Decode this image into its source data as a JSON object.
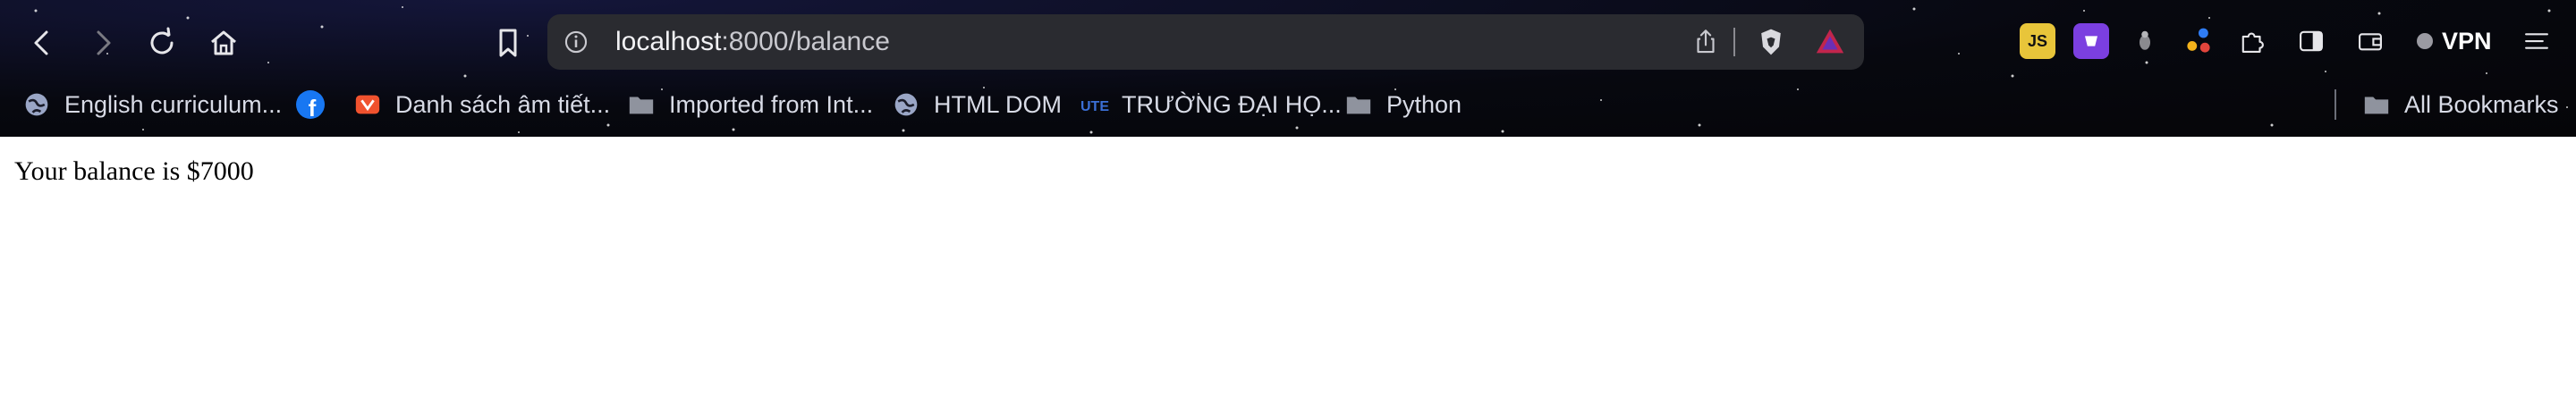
{
  "toolbar": {
    "back_icon": "back-arrow-icon",
    "forward_icon": "forward-arrow-icon",
    "reload_icon": "reload-icon",
    "home_icon": "home-icon",
    "bookmark_icon": "bookmark-icon"
  },
  "omnibox": {
    "url_host": "localhost",
    "url_path": ":8000/balance",
    "info_icon": "info-icon",
    "share_icon": "share-icon",
    "brave_shields_icon": "lion-shield-icon",
    "rewards_icon": "triangle-rewards-icon"
  },
  "extensions": {
    "vpn_label": "VPN"
  },
  "bookmarks": [
    {
      "label": "English curriculum...",
      "icon": "globe-icon"
    },
    {
      "label": "",
      "icon": "facebook-icon"
    },
    {
      "label": "Danh sách âm tiết...",
      "icon": "site-favicon-icon"
    },
    {
      "label": "Imported from Int...",
      "icon": "folder-icon"
    },
    {
      "label": "HTML DOM",
      "icon": "globe-icon"
    },
    {
      "label": "TRƯỜNG ĐẠI HỌ...",
      "icon": "ute-logo-icon"
    },
    {
      "label": "Python",
      "icon": "folder-icon"
    }
  ],
  "all_bookmarks_label": "All Bookmarks",
  "page": {
    "text": "Your balance is $7000"
  },
  "colors": {
    "toolbar_bg": "#07080f",
    "omnibox_bg": "#2a2b30",
    "text_light": "#d8dbe6"
  }
}
